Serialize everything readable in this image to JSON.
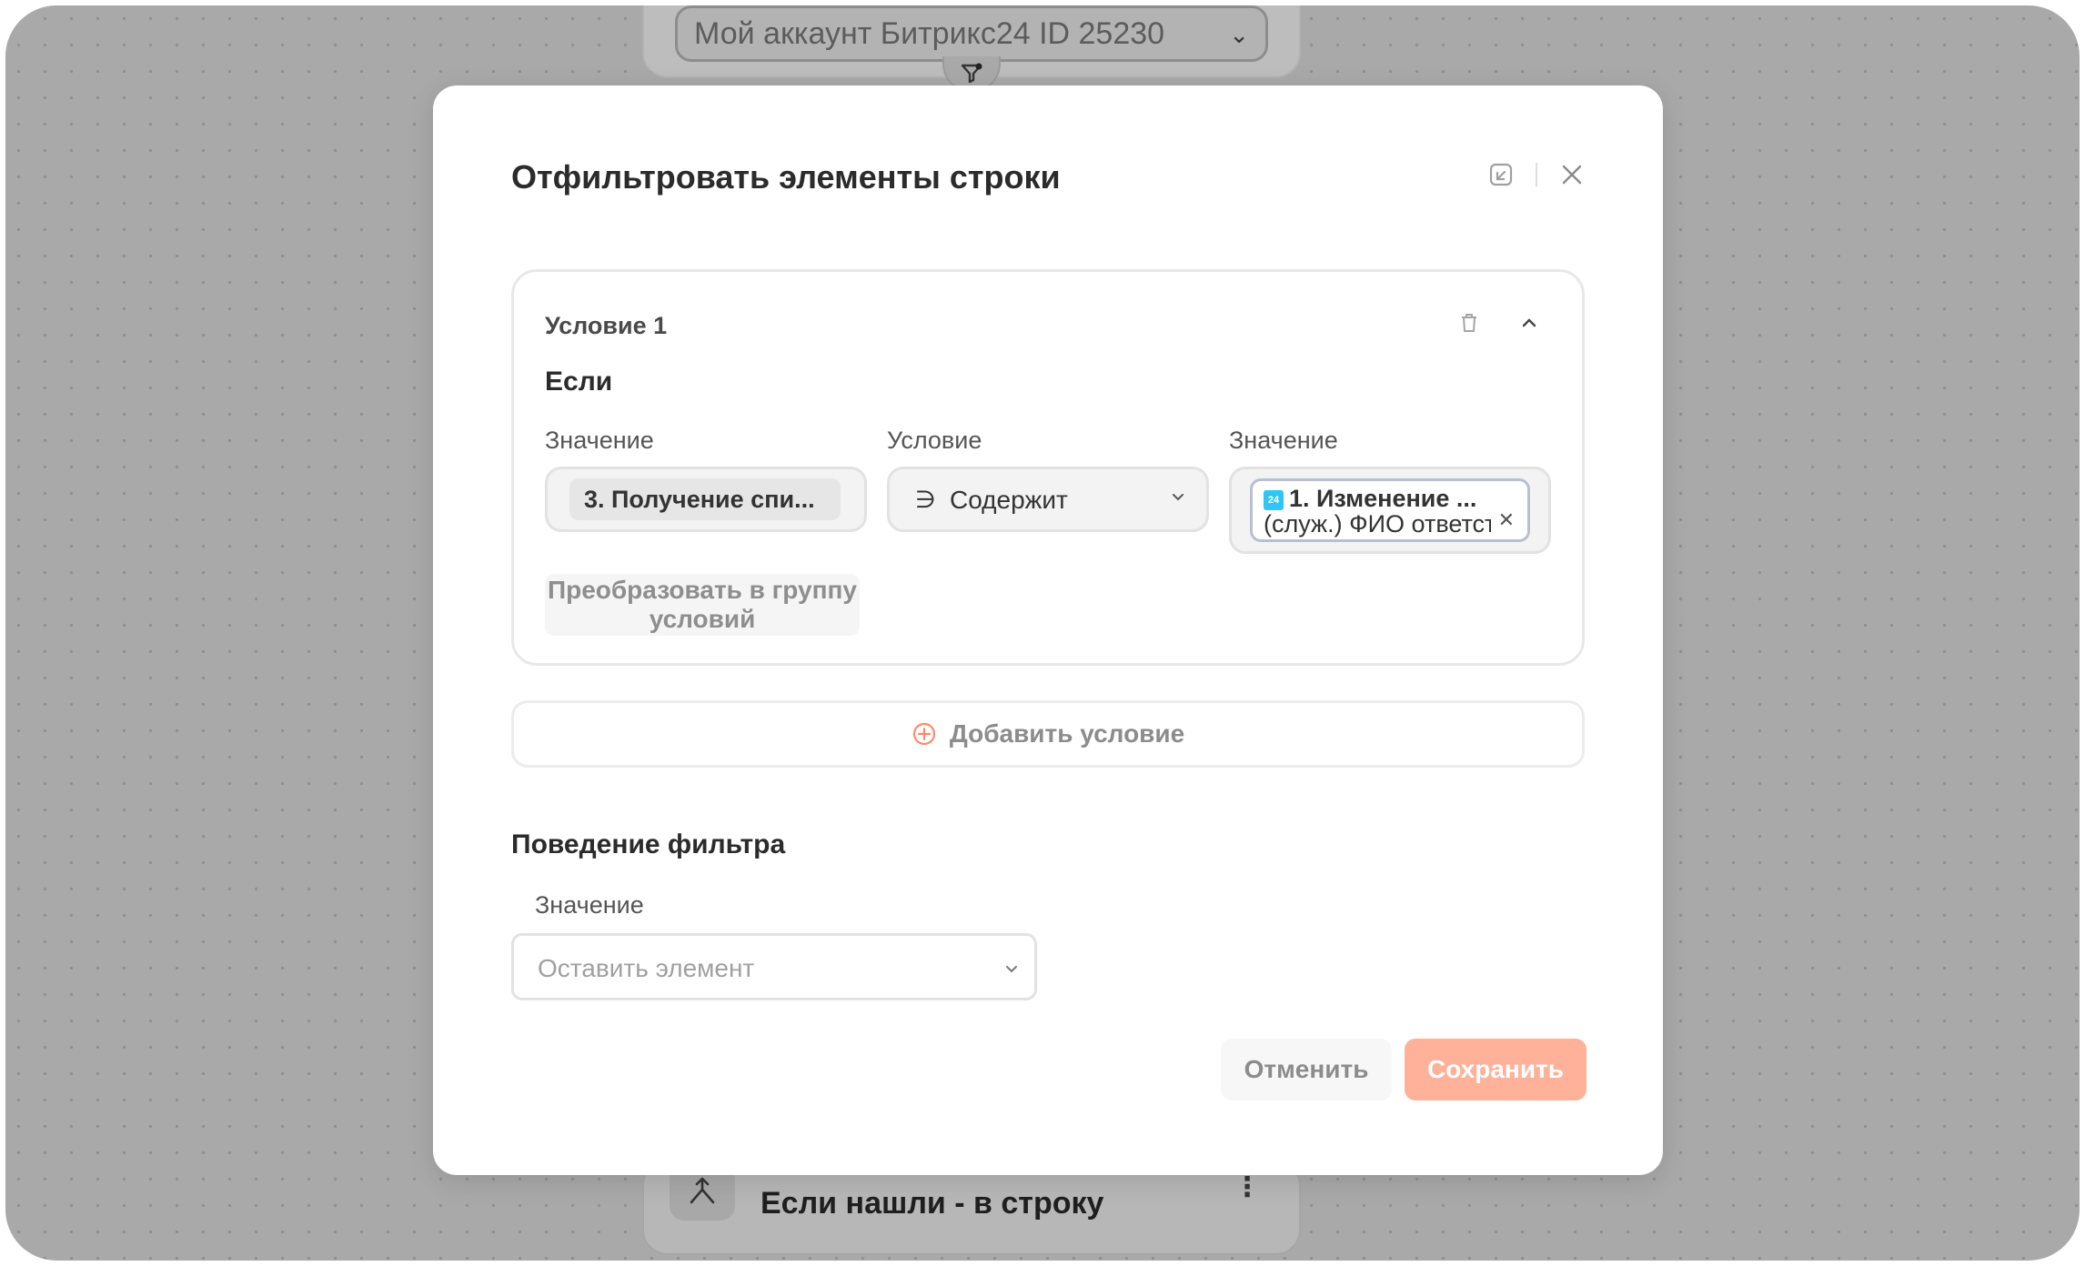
{
  "background": {
    "account_select": "Мой аккаунт Битрикс24 ID 25230",
    "bottom_node_title": "Если нашли - в строку"
  },
  "modal": {
    "title": "Отфильтровать элементы строки",
    "condition": {
      "title": "Условие 1",
      "if_label": "Если",
      "value_label_1": "Значение",
      "operator_label": "Условие",
      "value_label_2": "Значение",
      "left_value": "3. Получение спи...",
      "operator_symbol": "∋",
      "operator_value": "Содержит",
      "right_value_badge": "24",
      "right_value_line1": "1. Изменение ...",
      "right_value_line2": "(служ.) ФИО ответственного",
      "convert_button": "Преобразовать в группу условий"
    },
    "add_condition": "Добавить условие",
    "behavior": {
      "title": "Поведение фильтра",
      "label": "Значение",
      "placeholder": "Оставить элемент"
    },
    "cancel_button": "Отменить",
    "save_button": "Сохранить"
  },
  "colors": {
    "accent": "#ffb199",
    "add_icon": "#ff8a6b",
    "bitrix_badge": "#2fc6f6"
  }
}
